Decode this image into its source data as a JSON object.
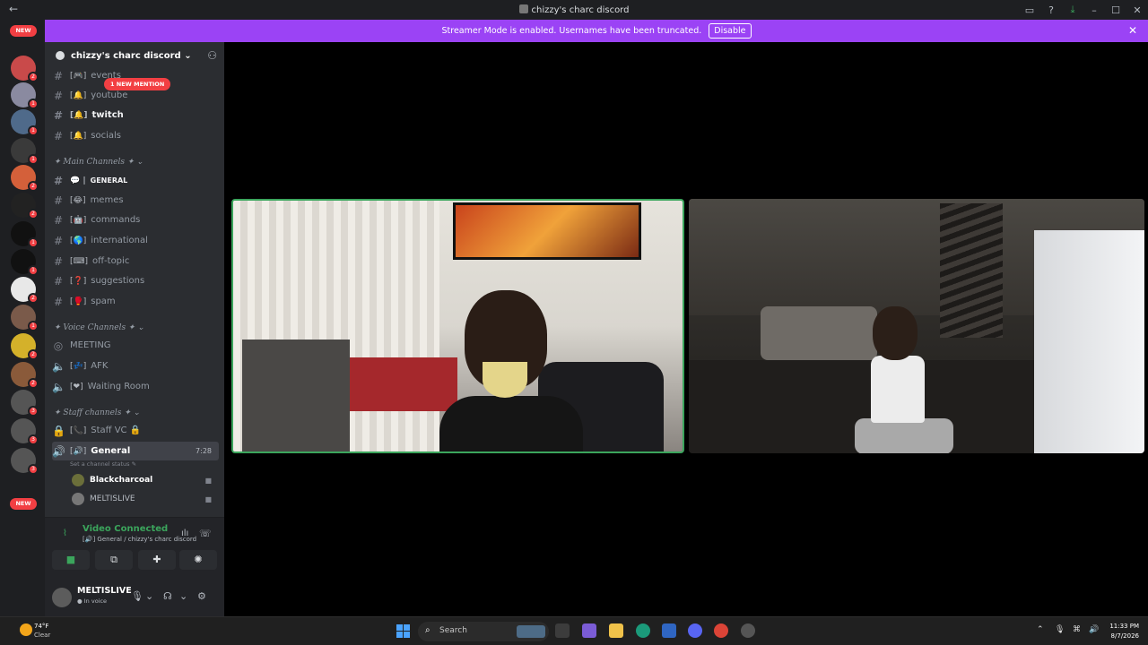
{
  "window": {
    "title": "chizzy's charc discord",
    "icons": [
      "back-icon",
      "inbox-icon",
      "help-icon",
      "download-icon",
      "minimize-icon",
      "maximize-icon",
      "close-icon"
    ]
  },
  "banner": {
    "text": "Streamer Mode is enabled. Usernames have been truncated.",
    "button_label": "Disable",
    "color": "#9b43f5"
  },
  "guild_rail": {
    "new_label_top": "NEW",
    "new_label_bottom": "NEW",
    "badges": [
      "2",
      "1",
      "1",
      "1",
      "2",
      "2",
      "1",
      "1",
      "2",
      "1",
      "2",
      "2",
      "3",
      "3",
      "3"
    ]
  },
  "server": {
    "name": "chizzy's charc discord",
    "mention_pill": "1 NEW MENTION"
  },
  "channels_top": [
    {
      "label": "events",
      "emoji": "🎮"
    },
    {
      "label": "youtube",
      "emoji": "🔔"
    },
    {
      "label": "twitch",
      "emoji": "🔔"
    },
    {
      "label": "socials",
      "emoji": "🔔"
    }
  ],
  "categories": {
    "main": "✦ Main Channels ✦",
    "voice": "✦ Voice Channels ✦",
    "staff": "✦ Staff channels ✦"
  },
  "main_channels": [
    {
      "label": "GENERAL",
      "emoji": "💬"
    },
    {
      "label": "memes",
      "emoji": "😂"
    },
    {
      "label": "commands",
      "emoji": "🤖"
    },
    {
      "label": "international",
      "emoji": "🌎"
    },
    {
      "label": "off-topic",
      "emoji": "⌨"
    },
    {
      "label": "suggestions",
      "emoji": "❓"
    },
    {
      "label": "spam",
      "emoji": "🥊"
    }
  ],
  "voice_channels": [
    {
      "label": "MEETING",
      "emoji": ""
    },
    {
      "label": "AFK",
      "emoji": "💤"
    },
    {
      "label": "Waiting Room",
      "emoji": "❤"
    }
  ],
  "staff_channels": [
    {
      "label": "Staff VC",
      "emoji": "📞",
      "suffix": "🔒"
    },
    {
      "label": "General",
      "emoji": "🔊",
      "time": "7:28"
    }
  ],
  "channel_status_placeholder": "Set a channel status",
  "voice_users": [
    {
      "name": "Blackcharcoal",
      "avatar_color": "#6b6f3a"
    },
    {
      "name": "MELTISLIVE",
      "avatar_color": "#777777"
    }
  ],
  "voice_panel": {
    "status": "Video Connected",
    "location": "General / chizzy's charc discord",
    "status_color": "#3ba55c"
  },
  "user": {
    "name": "MELTISLIVE",
    "status": "In voice"
  },
  "taskbar": {
    "temperature": "74°F",
    "condition": "Clear",
    "search_placeholder": "Search",
    "time": "11:33 PM",
    "date": "8/7/2026"
  }
}
